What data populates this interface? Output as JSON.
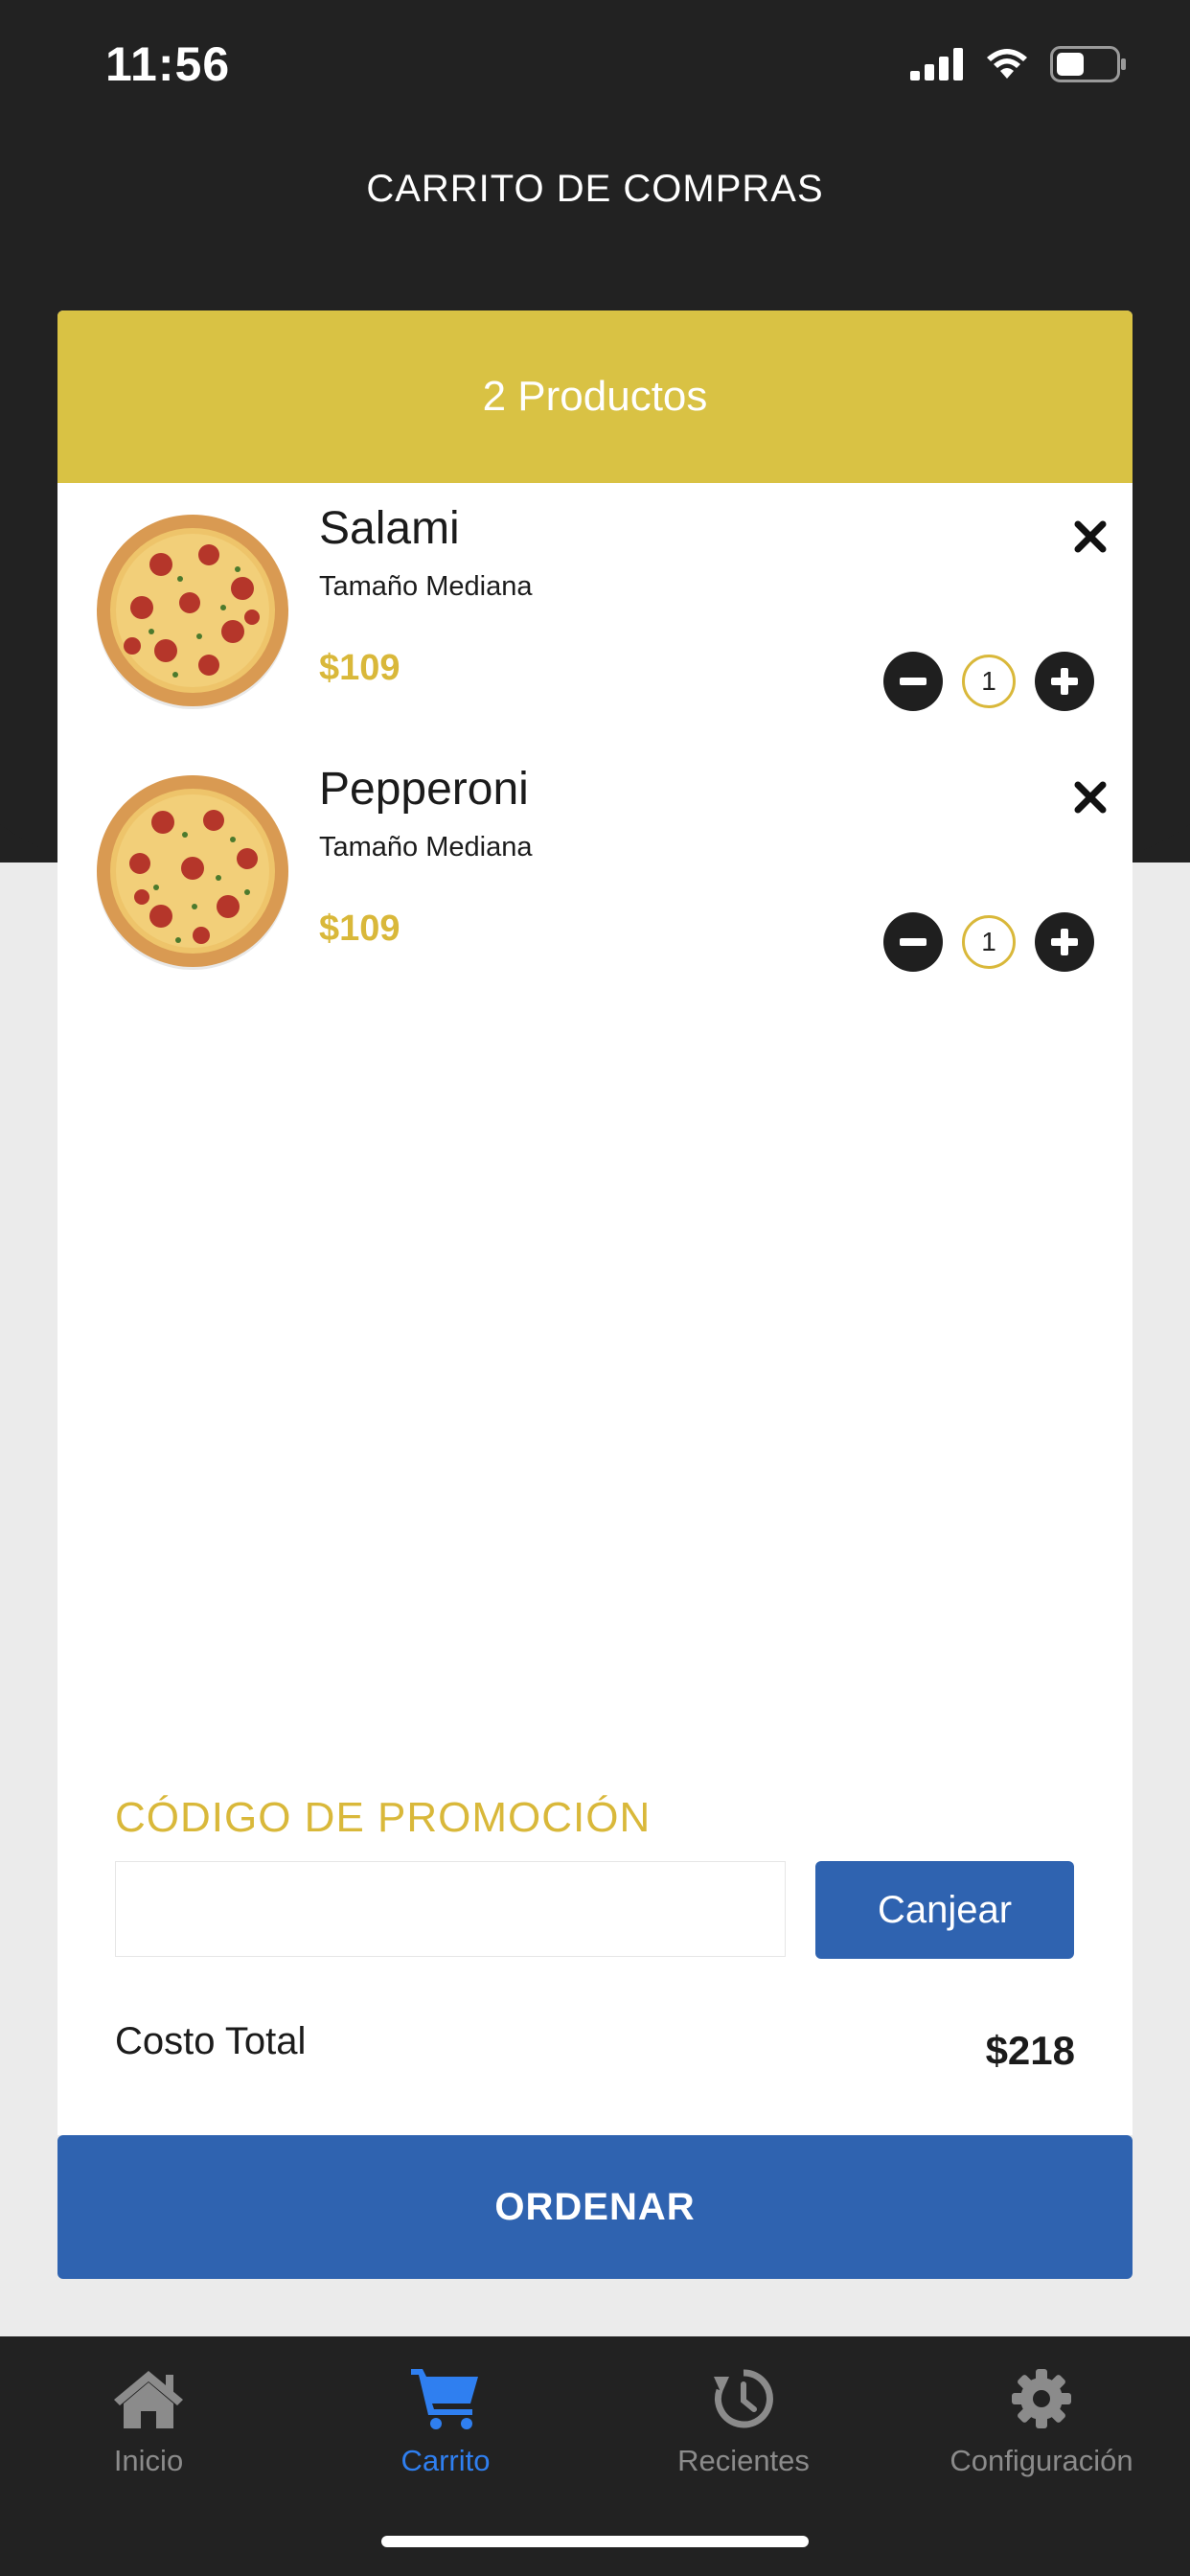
{
  "status_bar": {
    "time": "11:56"
  },
  "header": {
    "title": "CARRITO DE COMPRAS"
  },
  "cart": {
    "count_label": "2 Productos",
    "items": [
      {
        "name": "Salami",
        "size": "Tamaño Mediana",
        "price": "$109",
        "quantity": "1"
      },
      {
        "name": "Pepperoni",
        "size": "Tamaño Mediana",
        "price": "$109",
        "quantity": "1"
      }
    ]
  },
  "promo": {
    "label": "CÓDIGO DE PROMOCIÓN",
    "input_value": "",
    "redeem_label": "Canjear"
  },
  "total": {
    "label": "Costo Total",
    "value": "$218"
  },
  "order_button": {
    "label": "ORDENAR"
  },
  "tabs": [
    {
      "label": "Inicio",
      "icon": "home-icon",
      "active": false
    },
    {
      "label": "Carrito",
      "icon": "cart-icon",
      "active": true
    },
    {
      "label": "Recientes",
      "icon": "history-icon",
      "active": false
    },
    {
      "label": "Configuración",
      "icon": "gear-icon",
      "active": false
    }
  ],
  "colors": {
    "dark": "#222222",
    "gold": "#d9c244",
    "price_gold": "#d9b83a",
    "blue": "#2f63b0",
    "active_tab": "#2f7ff0"
  }
}
